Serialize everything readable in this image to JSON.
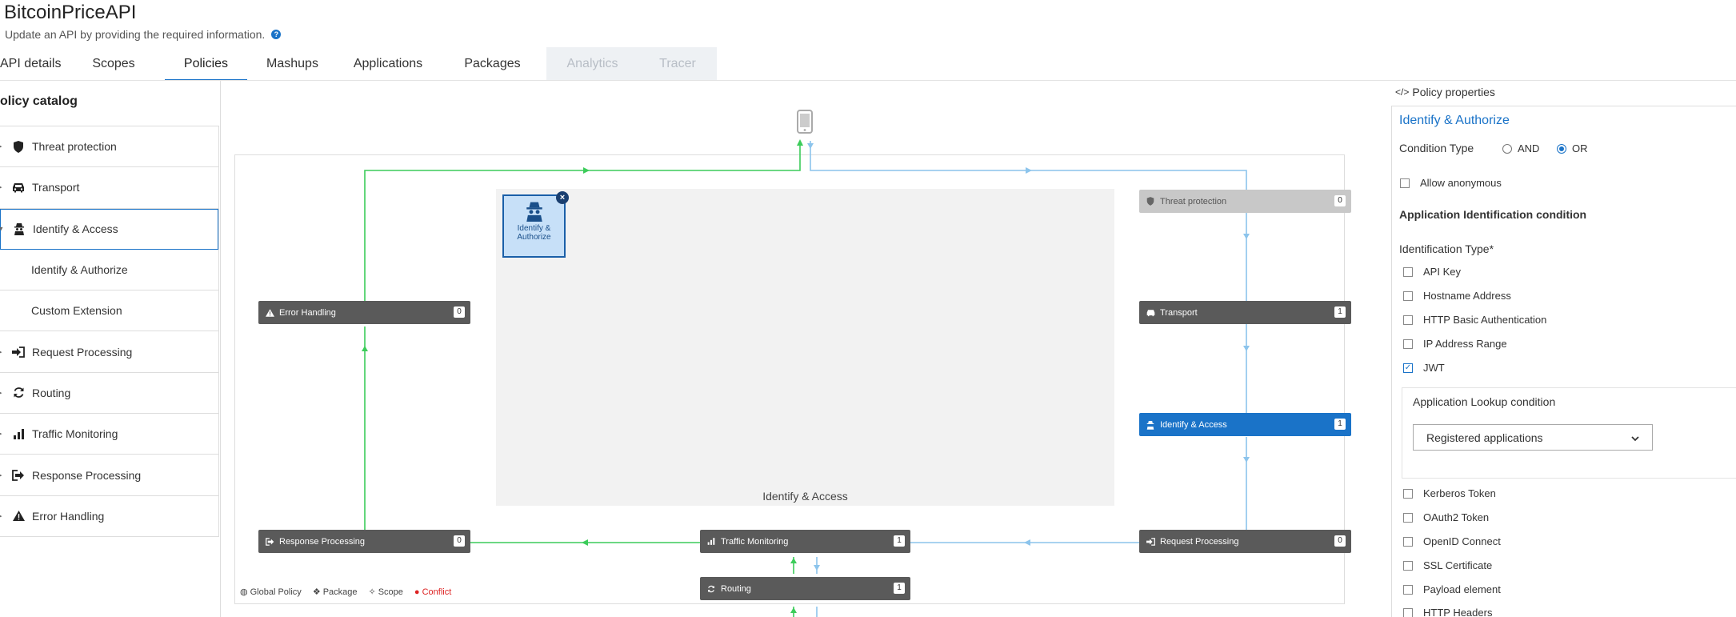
{
  "header": {
    "title": "BitcoinPriceAPI",
    "subtitle": "Update an API by providing the required information."
  },
  "tabs": [
    {
      "label": "API details"
    },
    {
      "label": "Scopes"
    },
    {
      "label": "Policies"
    },
    {
      "label": "Mashups"
    },
    {
      "label": "Applications"
    },
    {
      "label": "Packages"
    },
    {
      "label": "Analytics"
    },
    {
      "label": "Tracer"
    }
  ],
  "catalog": {
    "title": "olicy catalog",
    "items": [
      {
        "label": "Threat protection",
        "icon": "shield-icon"
      },
      {
        "label": "Transport",
        "icon": "car-icon"
      },
      {
        "label": "Identify & Access",
        "icon": "spy-icon"
      },
      {
        "label": "Identify & Authorize"
      },
      {
        "label": "Custom Extension"
      },
      {
        "label": "Request Processing",
        "icon": "sign-in-icon"
      },
      {
        "label": "Routing",
        "icon": "refresh-icon"
      },
      {
        "label": "Traffic Monitoring",
        "icon": "bar-chart-icon"
      },
      {
        "label": "Response Processing",
        "icon": "sign-out-icon"
      },
      {
        "label": "Error Handling",
        "icon": "warning-icon"
      }
    ]
  },
  "canvas": {
    "center_label": "Identify & Access",
    "policy_chip": {
      "line1": "Identify &",
      "line2": "Authorize"
    },
    "stages": {
      "threat": {
        "label": "Threat protection",
        "count": "0"
      },
      "transport": {
        "label": "Transport",
        "count": "1"
      },
      "identify": {
        "label": "Identify & Access",
        "count": "1"
      },
      "request": {
        "label": "Request Processing",
        "count": "0"
      },
      "traffic": {
        "label": "Traffic Monitoring",
        "count": "1"
      },
      "routing": {
        "label": "Routing",
        "count": "1"
      },
      "response": {
        "label": "Response Processing",
        "count": "0"
      },
      "error": {
        "label": "Error Handling",
        "count": "0"
      }
    },
    "legend": {
      "global": "Global Policy",
      "package": "Package",
      "scope": "Scope",
      "conflict": "Conflict"
    }
  },
  "properties": {
    "heading": "Policy properties",
    "title": "Identify & Authorize",
    "condition_type_label": "Condition Type",
    "and_label": "AND",
    "or_label": "OR",
    "allow_anonymous": "Allow anonymous",
    "app_id_condition": "Application Identification condition",
    "id_type_label": "Identification Type*",
    "id_types": [
      {
        "label": "API Key",
        "checked": false
      },
      {
        "label": "Hostname Address",
        "checked": false
      },
      {
        "label": "HTTP Basic Authentication",
        "checked": false
      },
      {
        "label": "IP Address Range",
        "checked": false
      },
      {
        "label": "JWT",
        "checked": true
      }
    ],
    "lookup_label": "Application Lookup condition",
    "lookup_value": "Registered applications",
    "more_types": [
      {
        "label": "Kerberos Token"
      },
      {
        "label": "OAuth2 Token"
      },
      {
        "label": "OpenID Connect"
      },
      {
        "label": "SSL Certificate"
      },
      {
        "label": "Payload element"
      },
      {
        "label": "HTTP Headers"
      }
    ]
  },
  "colors": {
    "accent": "#1a73c8",
    "green_line": "#3ccc5a",
    "blue_line": "#8cc4ec",
    "stage_dark": "#5a5a5a",
    "stage_active": "#1a73c8"
  }
}
